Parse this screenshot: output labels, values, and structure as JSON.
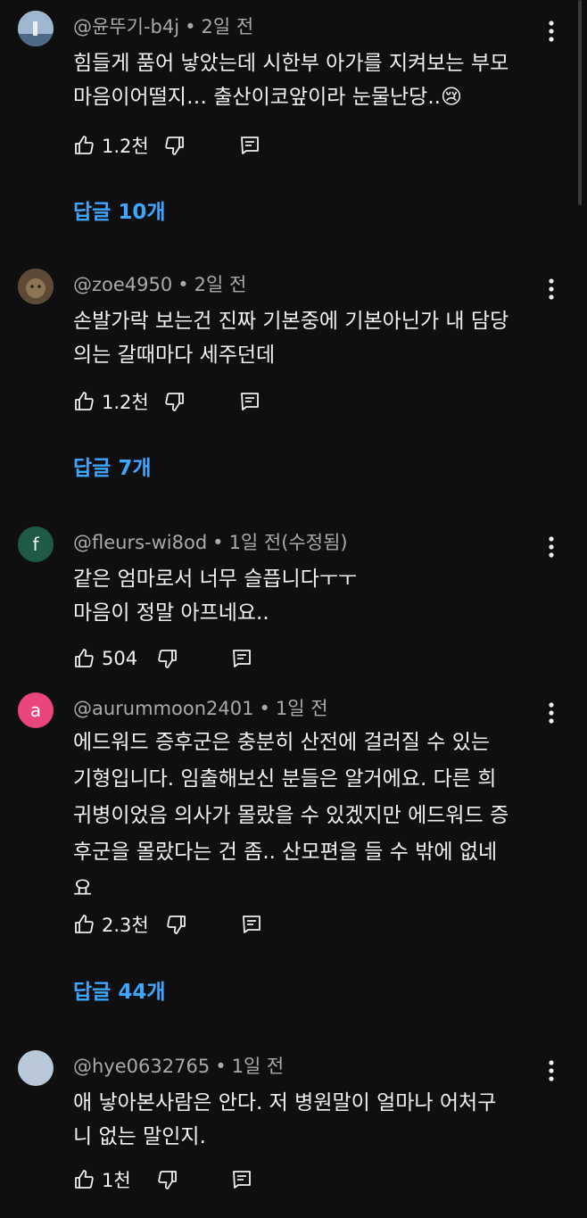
{
  "comments": [
    {
      "author": "@윤뚜기-b4j",
      "time": "2일 전",
      "avatar_color": "#8aa7c2",
      "avatar_letter": "",
      "lines": [
        "힘들게 품어 낳았는데 시한부 아가를 지켜보는 부모",
        "마음이어떨지… 출산이코앞이라 눈물난당..😢"
      ],
      "likes": "1.2천",
      "replies": "답글 10개"
    },
    {
      "author": "@zoe4950",
      "time": "2일 전",
      "avatar_color": "#6b5a44",
      "avatar_letter": "",
      "lines": [
        "손발가락 보는건 진짜 기본중에 기본아닌가 내 담당",
        "의는 갈때마다 세주던데"
      ],
      "likes": "1.2천",
      "replies": "답글 7개"
    },
    {
      "author": "@fleurs-wi8od",
      "time": "1일 전(수정됨)",
      "avatar_color": "#1f5a45",
      "avatar_letter": "f",
      "lines": [
        "같은 엄마로서 너무 슬픕니다ㅜㅜ",
        "마음이 정말 아프네요.."
      ],
      "likes": "504",
      "replies": ""
    },
    {
      "author": "@aurummoon2401",
      "time": "1일 전",
      "avatar_color": "#e8467c",
      "avatar_letter": "a",
      "lines": [
        "에드워드 증후군은 충분히 산전에 걸러질 수 있는",
        "기형입니다. 임출해보신 분들은 알거에요. 다른 희",
        "귀병이었음 의사가 몰랐을 수 있겠지만 에드워드 증",
        "후군을 몰랐다는 건 좀.. 산모편을 들 수 밖에 없네",
        "요"
      ],
      "likes": "2.3천",
      "replies": "답글 44개"
    },
    {
      "author": "@hye0632765",
      "time": "1일 전",
      "avatar_color": "#b9c9d9",
      "avatar_letter": "",
      "lines": [
        "애 낳아본사람은 안다. 저 병원말이 얼마나 어처구",
        "니 없는 말인지."
      ],
      "likes": "1천",
      "replies": ""
    }
  ],
  "icons": {
    "like": "thumbs-up-icon",
    "dislike": "thumbs-down-icon",
    "reply": "reply-comment-icon",
    "more": "more-vertical-icon"
  }
}
